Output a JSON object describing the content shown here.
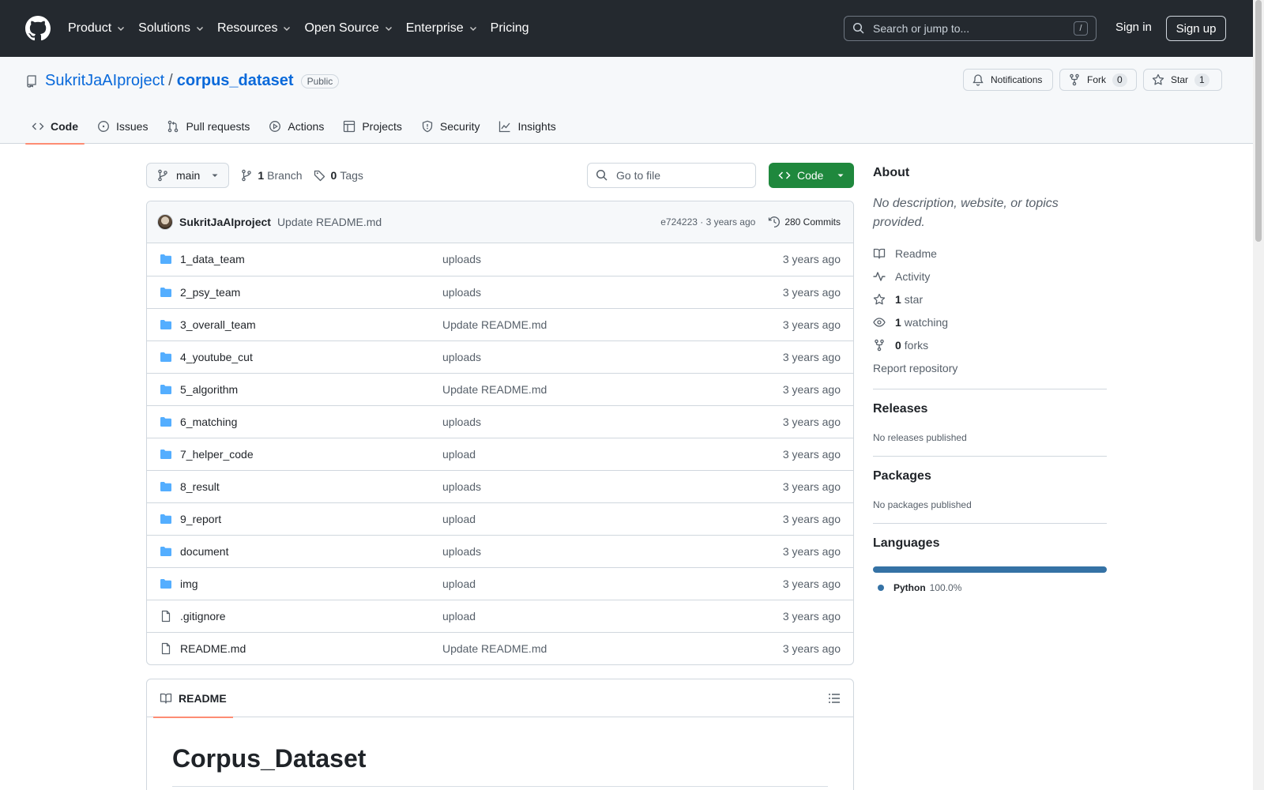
{
  "header": {
    "nav": [
      {
        "label": "Product",
        "dropdown": true
      },
      {
        "label": "Solutions",
        "dropdown": true
      },
      {
        "label": "Resources",
        "dropdown": true
      },
      {
        "label": "Open Source",
        "dropdown": true
      },
      {
        "label": "Enterprise",
        "dropdown": true
      },
      {
        "label": "Pricing",
        "dropdown": false
      }
    ],
    "search_placeholder": "Search or jump to...",
    "search_shortcut": "/",
    "sign_in": "Sign in",
    "sign_up": "Sign up"
  },
  "repo": {
    "owner": "SukritJaAIproject",
    "separator": "/",
    "name": "corpus_dataset",
    "visibility": "Public",
    "notifications_label": "Notifications",
    "fork_label": "Fork",
    "fork_count": "0",
    "star_label": "Star",
    "star_count": "1",
    "tabs": [
      {
        "label": "Code",
        "icon": "code-icon",
        "selected": true
      },
      {
        "label": "Issues",
        "icon": "issue-opened-icon",
        "selected": false
      },
      {
        "label": "Pull requests",
        "icon": "git-pull-request-icon",
        "selected": false
      },
      {
        "label": "Actions",
        "icon": "play-icon",
        "selected": false
      },
      {
        "label": "Projects",
        "icon": "table-icon",
        "selected": false
      },
      {
        "label": "Security",
        "icon": "shield-icon",
        "selected": false
      },
      {
        "label": "Insights",
        "icon": "graph-icon",
        "selected": false
      }
    ]
  },
  "toolbar": {
    "branch": "main",
    "branch_count": "1",
    "branch_label": "Branch",
    "tag_count": "0",
    "tag_label": "Tags",
    "goto_placeholder": "Go to file",
    "code_button": "Code"
  },
  "commit": {
    "author": "SukritJaAIproject",
    "message": "Update README.md",
    "sha_age": "e724223 · 3 years ago",
    "commits_label": "280 Commits"
  },
  "files": [
    {
      "type": "dir",
      "name": "1_data_team",
      "message": "uploads",
      "age": "3 years ago"
    },
    {
      "type": "dir",
      "name": "2_psy_team",
      "message": "uploads",
      "age": "3 years ago"
    },
    {
      "type": "dir",
      "name": "3_overall_team",
      "message": "Update README.md",
      "age": "3 years ago"
    },
    {
      "type": "dir",
      "name": "4_youtube_cut",
      "message": "uploads",
      "age": "3 years ago"
    },
    {
      "type": "dir",
      "name": "5_algorithm",
      "message": "Update README.md",
      "age": "3 years ago"
    },
    {
      "type": "dir",
      "name": "6_matching",
      "message": "uploads",
      "age": "3 years ago"
    },
    {
      "type": "dir",
      "name": "7_helper_code",
      "message": "upload",
      "age": "3 years ago"
    },
    {
      "type": "dir",
      "name": "8_result",
      "message": "uploads",
      "age": "3 years ago"
    },
    {
      "type": "dir",
      "name": "9_report",
      "message": "upload",
      "age": "3 years ago"
    },
    {
      "type": "dir",
      "name": "document",
      "message": "uploads",
      "age": "3 years ago"
    },
    {
      "type": "dir",
      "name": "img",
      "message": "upload",
      "age": "3 years ago"
    },
    {
      "type": "file",
      "name": ".gitignore",
      "message": "upload",
      "age": "3 years ago"
    },
    {
      "type": "file",
      "name": "README.md",
      "message": "Update README.md",
      "age": "3 years ago"
    }
  ],
  "readme": {
    "tab_label": "README",
    "heading": "Corpus_Dataset"
  },
  "about": {
    "title": "About",
    "description": "No description, website, or topics provided.",
    "readme_link": "Readme",
    "activity_link": "Activity",
    "stars_count": "1",
    "stars_label": "star",
    "watching_count": "1",
    "watching_label": "watching",
    "forks_count": "0",
    "forks_label": "forks",
    "report_link": "Report repository"
  },
  "releases": {
    "title": "Releases",
    "empty": "No releases published"
  },
  "packages": {
    "title": "Packages",
    "empty": "No packages published"
  },
  "languages": {
    "title": "Languages",
    "items": [
      {
        "name": "Python",
        "percent": "100.0%",
        "color": "#3572a5",
        "fraction": 1.0
      }
    ]
  },
  "colors": {
    "header_bg": "#24292f",
    "link": "#0969da",
    "primary_button": "#1f883d",
    "selected_tab_underline": "#fd8c73",
    "folder": "#54aeff"
  }
}
